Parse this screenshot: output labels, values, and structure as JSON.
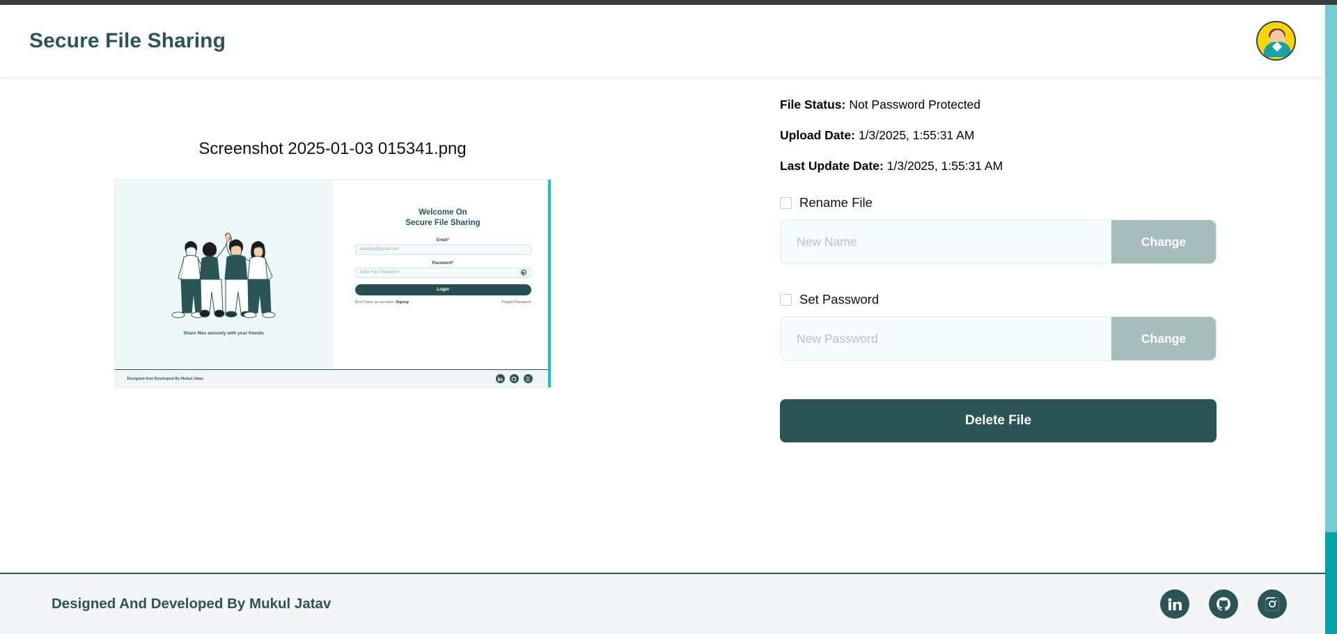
{
  "header": {
    "title": "Secure File Sharing",
    "avatar_alt": "user-avatar"
  },
  "preview": {
    "file_name": "Screenshot 2025-01-03 015341.png",
    "inner": {
      "tagline": "Share files securely with your friends",
      "welcome_line1": "Welcome On",
      "welcome_line2": "Secure File Sharing",
      "email_label": "Email",
      "email_required": "*",
      "email_placeholder": "example@gmail.com",
      "password_label": "Password",
      "password_required": "*",
      "password_placeholder": "Enter Your Password",
      "login_label": "Login",
      "signup_prompt": "Don't have an account.",
      "signup_link": "Signup",
      "forgot_link": "Forgot Password",
      "footer_text": "Designed And Developed By Mukul Jatav"
    }
  },
  "details": {
    "file_status_label": "File Status:",
    "file_status_value": "Not Password Protected",
    "upload_date_label": "Upload Date:",
    "upload_date_value": "1/3/2025, 1:55:31 AM",
    "last_update_label": "Last Update Date:",
    "last_update_value": "1/3/2025, 1:55:31 AM"
  },
  "rename": {
    "checkbox_label": "Rename File",
    "input_value": "",
    "input_placeholder": "New Name",
    "button_label": "Change"
  },
  "password": {
    "checkbox_label": "Set Password",
    "input_value": "",
    "input_placeholder": "New Password",
    "button_label": "Change"
  },
  "actions": {
    "delete_label": "Delete File"
  },
  "footer": {
    "credit": "Designed And Developed By Mukul Jatav",
    "socials": [
      {
        "name": "linkedin-icon"
      },
      {
        "name": "github-icon"
      },
      {
        "name": "instagram-icon"
      }
    ]
  },
  "colors": {
    "brand_teal": "#2b5457",
    "muted_button": "#a7bdbb",
    "field_bg": "#f6fbfb",
    "avatar_yellow": "#ffd400",
    "scrollbar": "#74cdd4"
  }
}
